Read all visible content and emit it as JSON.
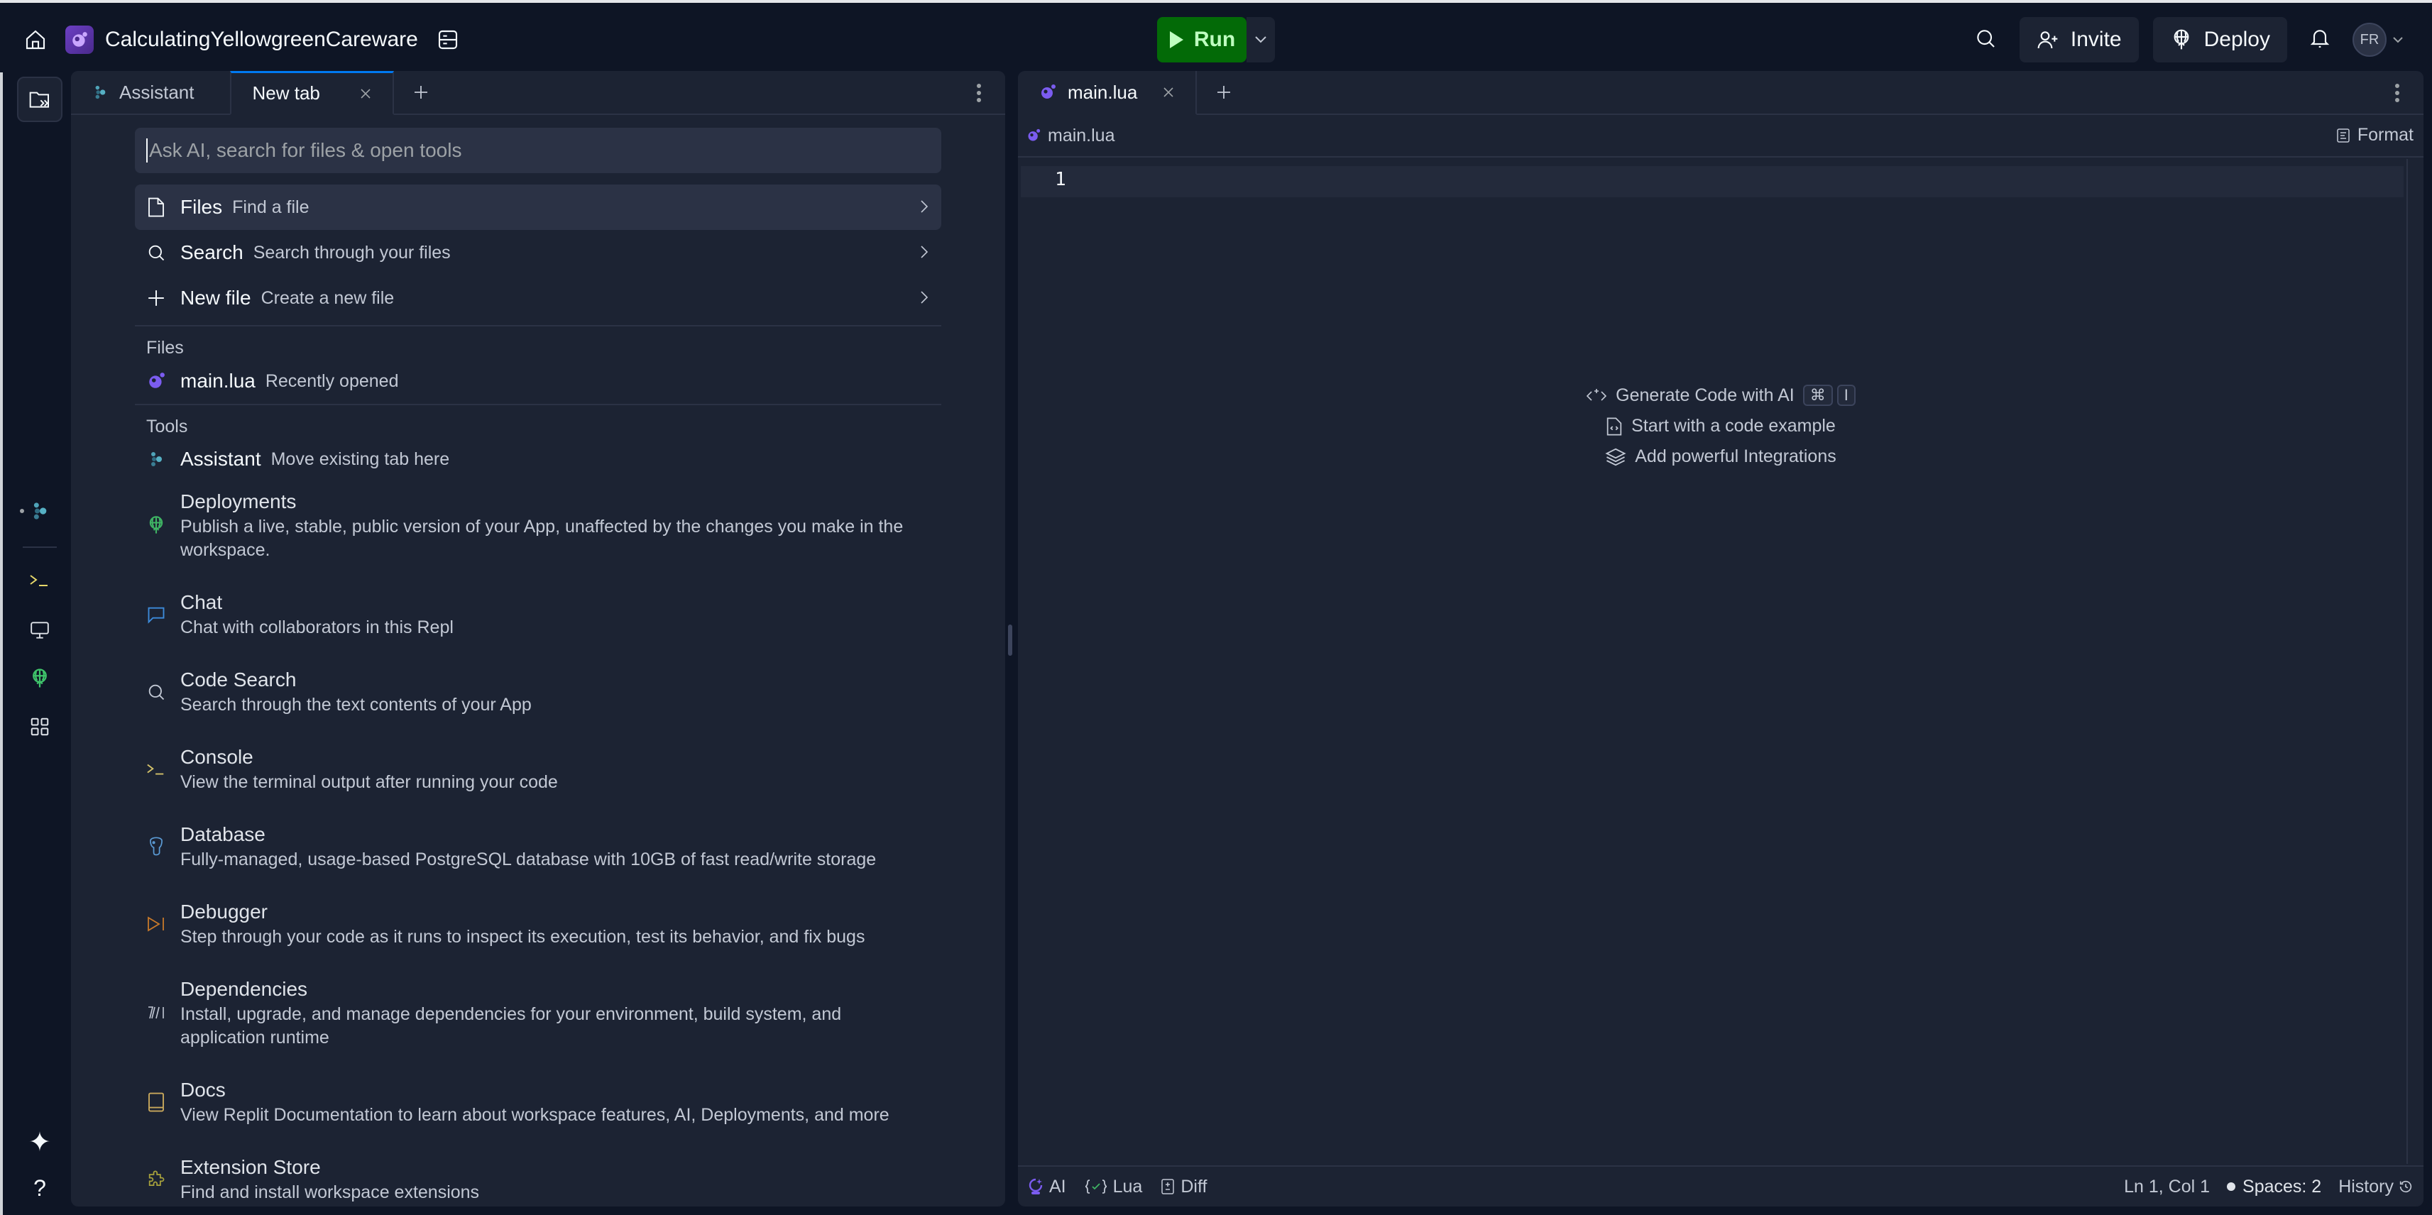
{
  "topbar": {
    "repl_name": "CalculatingYellowgreenCareware",
    "run_label": "Run",
    "invite_label": "Invite",
    "deploy_label": "Deploy",
    "avatar_initials": "FR"
  },
  "left_pane": {
    "tabs": [
      {
        "label": "Assistant",
        "icon": "assistant-icon",
        "active": false
      },
      {
        "label": "New tab",
        "icon": null,
        "active": true
      }
    ],
    "search_placeholder": "Ask AI, search for files & open tools",
    "commands": [
      {
        "title": "Files",
        "subtitle": "Find a file",
        "icon": "file-icon",
        "selected": true
      },
      {
        "title": "Search",
        "subtitle": "Search through your files",
        "icon": "search-icon",
        "selected": false
      },
      {
        "title": "New file",
        "subtitle": "Create a new file",
        "icon": "plus-icon",
        "selected": false
      }
    ],
    "files_section_label": "Files",
    "recent_file": {
      "name": "main.lua",
      "note": "Recently opened"
    },
    "tools_section_label": "Tools",
    "assistant_tool": {
      "title": "Assistant",
      "subtitle": "Move existing tab here"
    },
    "tools": [
      {
        "title": "Deployments",
        "desc": "Publish a live, stable, public version of your App, unaffected by the changes you make in the workspace.",
        "icon": "deployments-icon",
        "color": "#3fb464"
      },
      {
        "title": "Chat",
        "desc": "Chat with collaborators in this Repl",
        "icon": "chat-icon",
        "color": "#3d8bdb"
      },
      {
        "title": "Code Search",
        "desc": "Search through the text contents of your App",
        "icon": "code-search-icon",
        "color": "#c2c8d4"
      },
      {
        "title": "Console",
        "desc": "View the terminal output after running your code",
        "icon": "console-icon",
        "color": "#d4c26a"
      },
      {
        "title": "Database",
        "desc": "Fully-managed, usage-based PostgreSQL database with 10GB of fast read/write storage",
        "icon": "database-icon",
        "color": "#5b9bd5"
      },
      {
        "title": "Debugger",
        "desc": "Step through your code as it runs to inspect its execution, test its behavior, and fix bugs",
        "icon": "debugger-icon",
        "color": "#c8792a"
      },
      {
        "title": "Dependencies",
        "desc": "Install, upgrade, and manage dependencies for your environment, build system, and application runtime",
        "icon": "dependencies-icon",
        "color": "#c2c8d4"
      },
      {
        "title": "Docs",
        "desc": "View Replit Documentation to learn about workspace features, AI, Deployments, and more",
        "icon": "docs-icon",
        "color": "#c9a85c"
      },
      {
        "title": "Extension Store",
        "desc": "Find and install workspace extensions",
        "icon": "extension-icon",
        "color": "#a8a23c"
      }
    ]
  },
  "right_pane": {
    "tab_label": "main.lua",
    "breadcrumb": "main.lua",
    "format_label": "Format",
    "line_number": "1",
    "hints": {
      "generate": "Generate Code with AI",
      "kbd_cmd": "⌘",
      "kbd_key": "I",
      "example": "Start with a code example",
      "integrations": "Add powerful Integrations"
    },
    "status": {
      "ai": "AI",
      "lang": "Lua",
      "diff": "Diff",
      "position": "Ln 1, Col 1",
      "spaces": "Spaces: 2",
      "history": "History"
    }
  },
  "colors": {
    "run_bg": "#036a07",
    "run_text": "#bfffc0",
    "accent_tab": "#0079f2",
    "lua_purple": "#7b5cf0"
  }
}
